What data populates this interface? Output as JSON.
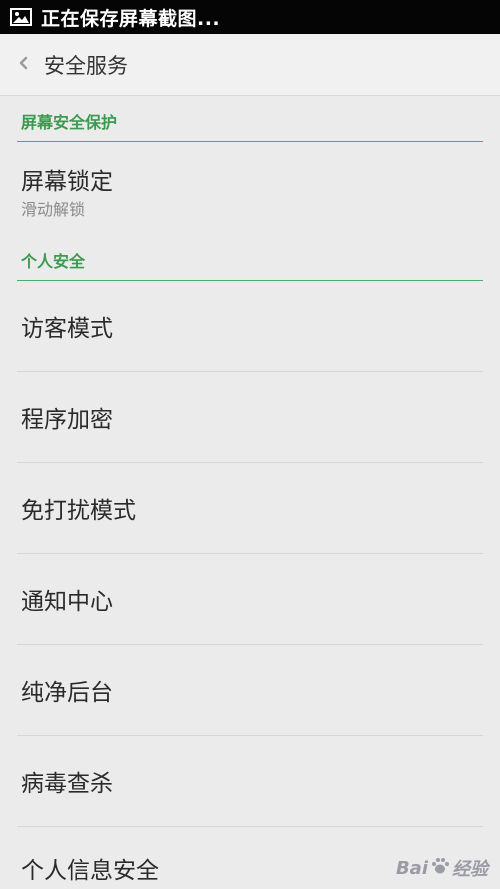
{
  "status_bar": {
    "notification_icon": "image-icon",
    "text": "正在保存屏幕截图..."
  },
  "header": {
    "back_icon": "chevron-left-icon",
    "title": "安全服务"
  },
  "sections": [
    {
      "title": "屏幕安全保护",
      "items": [
        {
          "title": "屏幕锁定",
          "subtitle": "滑动解锁"
        }
      ]
    },
    {
      "title": "个人安全",
      "items": [
        {
          "title": "访客模式"
        },
        {
          "title": "程序加密"
        },
        {
          "title": "免打扰模式"
        },
        {
          "title": "通知中心"
        },
        {
          "title": "纯净后台"
        },
        {
          "title": "病毒查杀"
        },
        {
          "title": "个人信息安全"
        }
      ]
    }
  ],
  "watermark": {
    "logo": "Bai",
    "suffix": "经验"
  },
  "colors": {
    "accent_green": "#3a9a4f",
    "status_bar_bg": "#050505",
    "background": "#ebebeb"
  }
}
